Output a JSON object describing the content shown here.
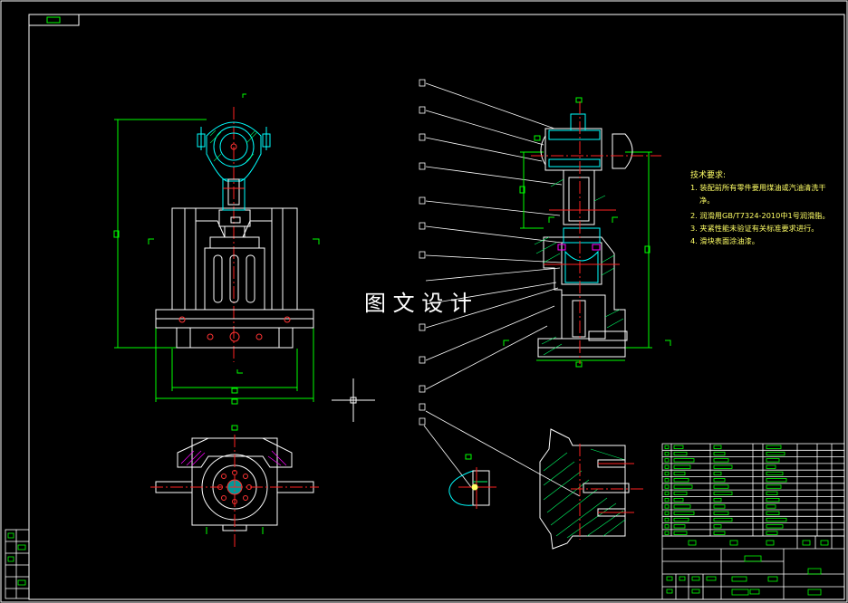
{
  "drawing": {
    "background": "#000000",
    "line_color": "#ffffff",
    "dimension_color": "#00ff00",
    "centerline_color": "#ff2222",
    "part_color": "#00ffff",
    "hatch_color": "#00ff66",
    "note_color": "#ffff66",
    "accent_color": "#ff00ff"
  },
  "watermark": "图 文 设 计",
  "technical_requirements": {
    "title": "技术要求:",
    "items": [
      "1. 装配前所有零件要用煤油或汽油清洗干",
      "净。",
      "2. 润滑用GB/T7324-2010中1号润滑脂。",
      "3. 夹紧性能未验证有关标准要求进行。",
      "4. 滑块表面涂油漆。"
    ]
  }
}
